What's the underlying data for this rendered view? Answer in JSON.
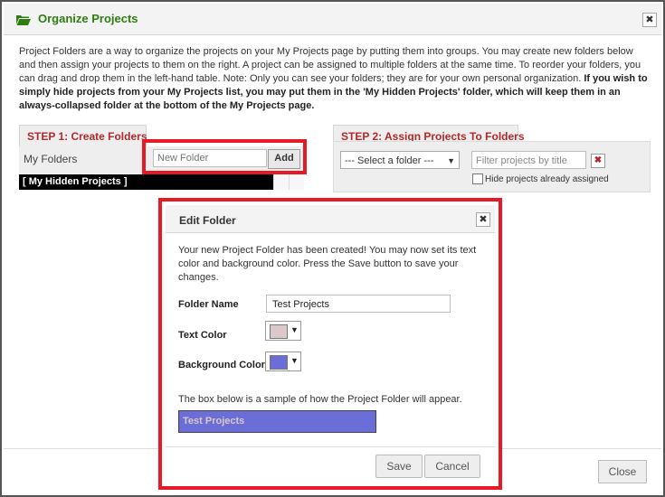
{
  "dialog": {
    "title": "Organize Projects",
    "close_glyph": "✖",
    "close_button": "Close",
    "intro_normal": "Project Folders are a way to organize the projects on your My Projects page by putting them into groups. You may create new folders below and then assign your projects to them on the right. A project can be assigned to multiple folders at the same time. To reorder your folders, you can drag and drop them in the left-hand table. Note: Only you can see your folders; they are for your own personal organization. ",
    "intro_bold": "If you wish to simply hide projects from your My Projects list, you may put them in the 'My Hidden Projects' folder, which will keep them in an always-collapsed folder at the bottom of the My Projects page.",
    "title_color": "#2e7d12",
    "title_icon": "folder-open-icon"
  },
  "step1": {
    "tab": "STEP 1: Create Folders",
    "my_folders": "My Folders",
    "new_folder_placeholder": "New Folder",
    "add_label": "Add",
    "hidden_folder": "[ My Hidden Projects ]"
  },
  "step2": {
    "tab": "STEP 2: Assign Projects To Folders",
    "select_value": "--- Select a folder ---",
    "filter_placeholder": "Filter projects by title",
    "clear_glyph": "✖",
    "hide_assigned": "Hide projects already assigned"
  },
  "edit": {
    "title": "Edit Folder",
    "close_glyph": "✖",
    "message": "Your new Project Folder has been created! You may now set its text color and background color. Press the Save button to save your changes.",
    "folder_name_label": "Folder Name",
    "folder_name_value": "Test Projects",
    "text_color_label": "Text Color",
    "bg_color_label": "Background Color",
    "sample_note": "The box below is a sample of how the Project Folder will appear.",
    "sample_text": "Test Projects",
    "save_label": "Save",
    "cancel_label": "Cancel",
    "caret": "▼",
    "text_color": "#dcc8c8",
    "bg_color": "#6a6ed6"
  },
  "colors": {
    "highlight": "#e51a24",
    "step_tab_text": "#b22a2a"
  }
}
